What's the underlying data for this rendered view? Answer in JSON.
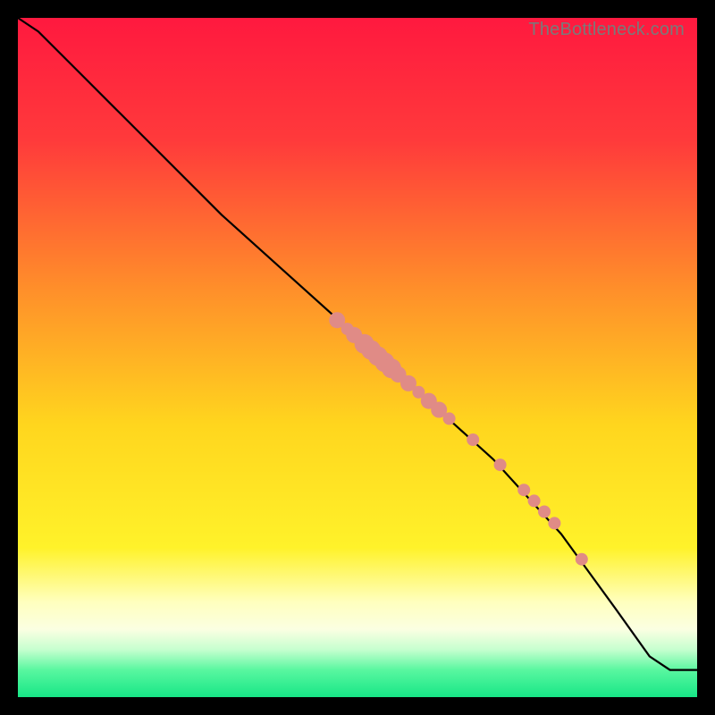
{
  "watermark": "TheBottleneck.com",
  "colors": {
    "frame": "#000000",
    "line": "#000000",
    "dot": "#e08b86",
    "gradient_stops": [
      {
        "pct": 0,
        "color": "#ff193f"
      },
      {
        "pct": 18,
        "color": "#ff3a3b"
      },
      {
        "pct": 40,
        "color": "#ff8f2a"
      },
      {
        "pct": 60,
        "color": "#ffd61e"
      },
      {
        "pct": 78,
        "color": "#fff22a"
      },
      {
        "pct": 86,
        "color": "#ffffbe"
      },
      {
        "pct": 90,
        "color": "#fbffe2"
      },
      {
        "pct": 93,
        "color": "#c6ffcf"
      },
      {
        "pct": 96,
        "color": "#59f7a0"
      },
      {
        "pct": 100,
        "color": "#17e686"
      }
    ]
  },
  "chart_data": {
    "type": "line",
    "title": "",
    "xlabel": "",
    "ylabel": "",
    "xlim": [
      0,
      100
    ],
    "ylim": [
      0,
      100
    ],
    "series": [
      {
        "name": "baseline-curve",
        "x": [
          0,
          3,
          6,
          10,
          15,
          20,
          30,
          40,
          50,
          60,
          70,
          80,
          88,
          93,
          96,
          100
        ],
        "y": [
          100,
          98,
          95,
          91,
          86,
          81,
          71,
          62,
          53,
          44,
          35,
          24,
          13,
          6,
          4,
          4
        ]
      }
    ],
    "points": {
      "name": "highlighted-points",
      "x": [
        47,
        48.5,
        49.5,
        51,
        52,
        53,
        54,
        55,
        56,
        57.5,
        59,
        60.5,
        62,
        63.5,
        67,
        71,
        74.5,
        76,
        77.5,
        79,
        83
      ],
      "y": [
        55.5,
        54.2,
        53.3,
        52.0,
        51.1,
        50.2,
        49.3,
        48.4,
        47.5,
        46.2,
        44.9,
        43.6,
        42.3,
        41.0,
        37.9,
        34.2,
        30.5,
        28.9,
        27.3,
        25.6,
        20.3
      ],
      "r": [
        9,
        7,
        9,
        11,
        11,
        11,
        11,
        11,
        9,
        9,
        7,
        9,
        9,
        7,
        7,
        7,
        7,
        7,
        7,
        7,
        7
      ]
    }
  }
}
